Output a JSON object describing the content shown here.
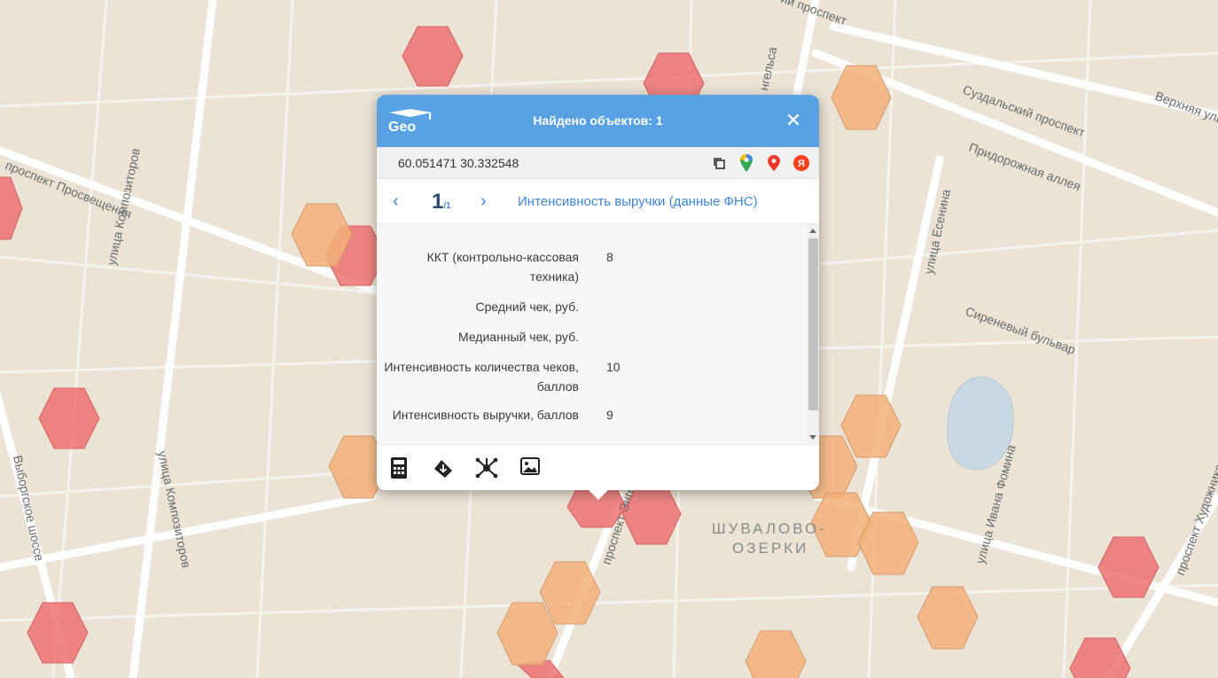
{
  "header": {
    "logo_text": "Geo",
    "title": "Найдено объектов: 1",
    "close_symbol": "✕"
  },
  "coords": {
    "text": "60.051471 30.332548",
    "icons": [
      "copy-icon",
      "google-maps-icon",
      "map-pin-icon",
      "yandex-icon"
    ],
    "yandex_letter": "Я"
  },
  "nav": {
    "prev_symbol": "‹",
    "next_symbol": "›",
    "page": "1",
    "total": "/1",
    "layer": "Интенсивность выручки (данные ФНС)"
  },
  "attributes": [
    {
      "label": "ККТ (контрольно-кассовая техника)",
      "value": "8"
    },
    {
      "label": "Средний чек, руб.",
      "value": ""
    },
    {
      "label": "Медианный чек, руб.",
      "value": ""
    },
    {
      "label": "Интенсивность количества чеков, баллов",
      "value": "10"
    },
    {
      "label": "Интенсивность выручки, баллов",
      "value": "9"
    }
  ],
  "toolbar": [
    "calculator-icon",
    "download-icon",
    "network-icon",
    "image-icon"
  ],
  "map": {
    "streets": [
      "проспект Просвещения",
      "улица Композиторов",
      "улица Композиторов",
      "Выборгское шоссе",
      "Суздальский проспект",
      "Придорожная аллея",
      "улица Есенина",
      "Сиреневый бульвар",
      "улица Ивана Фомина",
      "проспект Художников",
      "проспект Энгельса",
      "Верхняя улица",
      "нгельса",
      "ий проспект"
    ],
    "district": [
      "ШУВАЛОВО-",
      "ОЗЕРКИ"
    ],
    "hex_colors": {
      "high": "#ec7272",
      "medium": "#f3b07a"
    }
  }
}
